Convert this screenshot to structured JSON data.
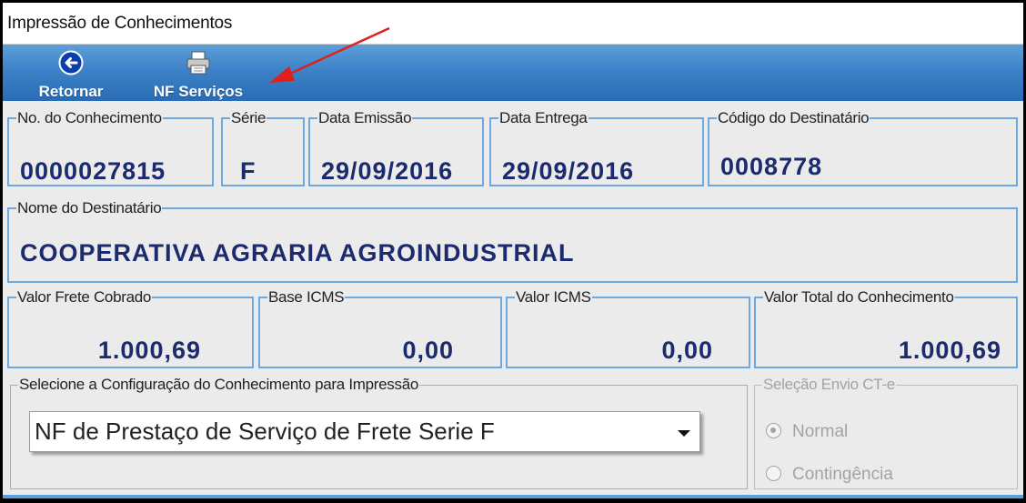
{
  "window": {
    "title": "Impressão de Conhecimentos"
  },
  "toolbar": {
    "return_label": "Retornar",
    "return_icon": "back-arrow-circle-icon",
    "nf_label": "NF Serviços",
    "nf_icon": "printer-icon"
  },
  "fields": {
    "conhecimento": {
      "label": "No. do Conhecimento",
      "value": "0000027815"
    },
    "serie": {
      "label": "Série",
      "value": "F"
    },
    "data_emissao": {
      "label": "Data Emissão",
      "value": "29/09/2016"
    },
    "data_entrega": {
      "label": "Data Entrega",
      "value": "29/09/2016"
    },
    "codigo_destinatario": {
      "label": "Código do Destinatário",
      "value": "0008778"
    },
    "nome_destinatario": {
      "label": "Nome do Destinatário",
      "value": "COOPERATIVA AGRARIA AGROINDUSTRIAL"
    },
    "valor_frete": {
      "label": "Valor Frete Cobrado",
      "value": "1.000,69"
    },
    "base_icms": {
      "label": "Base ICMS",
      "value": "0,00"
    },
    "valor_icms": {
      "label": "Valor ICMS",
      "value": "0,00"
    },
    "valor_total": {
      "label": "Valor Total do Conhecimento",
      "value": "1.000,69"
    }
  },
  "config": {
    "label": "Selecione a Configuração do Conhecimento para Impressão",
    "selected": "NF de Prestaço de Serviço de Frete Serie F"
  },
  "envio": {
    "label": "Seleção Envio CT-e",
    "options": [
      "Normal",
      "Contingência"
    ],
    "selected": "Normal"
  },
  "colors": {
    "accent": "#3d82c8",
    "value_text": "#1c2a6e",
    "annotation_arrow": "#e0201c"
  }
}
